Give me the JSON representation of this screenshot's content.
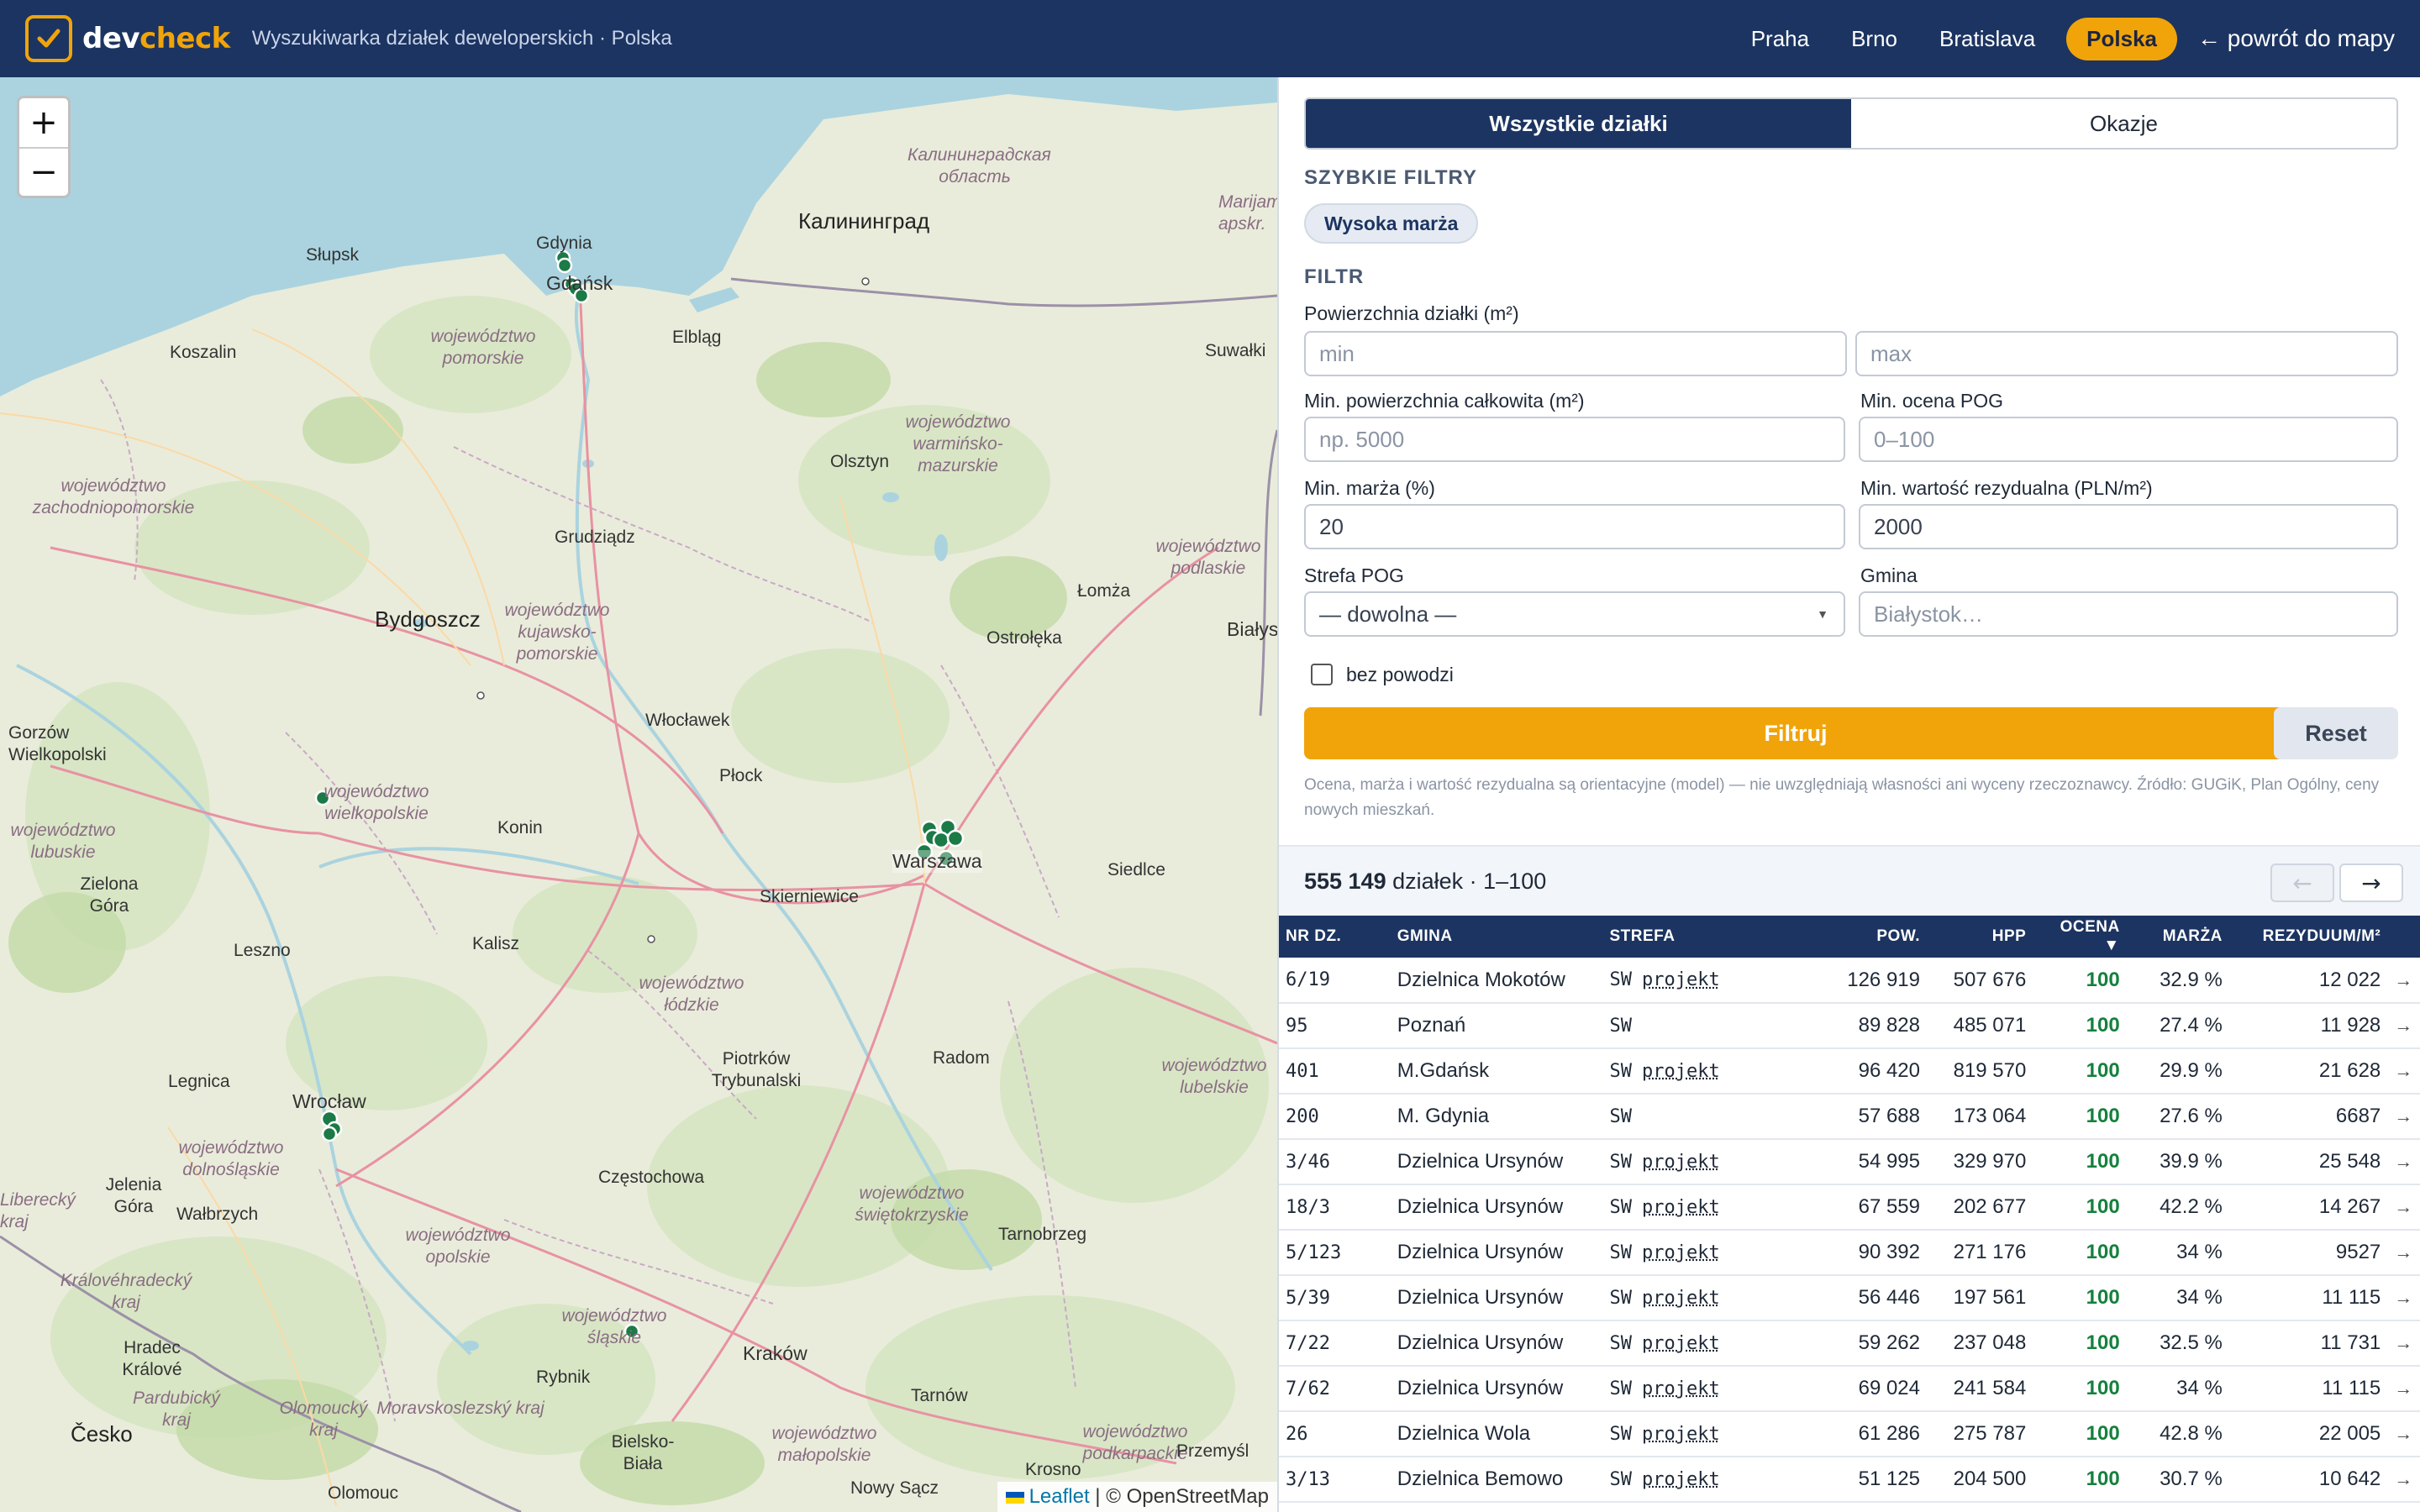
{
  "header": {
    "logo_dev": "dev",
    "logo_check": "check",
    "subtitle": "Wyszukiwarka działek deweloperskich · Polska",
    "nav": [
      "Praha",
      "Brno",
      "Bratislava",
      "Polska"
    ],
    "nav_active": "Polska",
    "back_link": "← powrót do mapy"
  },
  "map": {
    "zoom_in": "+",
    "zoom_out": "−",
    "attribution_leaflet": "Leaflet",
    "attribution_sep": " | © OpenStreetMap",
    "labels": {
      "kaliningrad_region": "Калининградская область",
      "kaliningrad": "Калининград",
      "marijampole": "Marijampolė apskr.",
      "slupsk": "Słupsk",
      "gdynia": "Gdynia",
      "gdansk": "Gdańsk",
      "koszalin": "Koszalin",
      "pomorskie": "województwo pomorskie",
      "elblag": "Elbląg",
      "suwalki": "Suwałki",
      "warminsko": "województwo warmińsko-mazurskie",
      "olsztyn": "Olsztyn",
      "zachodnio": "województwo zachodniopomorskie",
      "grudziadz": "Grudziądz",
      "podlaskie": "województwo podlaskie",
      "lomza": "Łomża",
      "bydgoszcz": "Bydgoszcz",
      "kujawsko": "województwo kujawsko-pomorskie",
      "ostroleka": "Ostrołęka",
      "bialystok": "Białystok",
      "wloclawek": "Włocławek",
      "gorzow": "Gorzów Wielkopolski",
      "wielkopolskie": "województwo wielkopolskie",
      "plock": "Płock",
      "lubuskie": "województwo lubuskie",
      "konin": "Konin",
      "warszawa": "Warszawa",
      "siedlce": "Siedlce",
      "zielona": "Zielona Góra",
      "skierniewice": "Skierniewice",
      "kalisz": "Kalisz",
      "leszno": "Leszno",
      "lodzkie": "województwo łódzkie",
      "piotrkow": "Piotrków Trybunalski",
      "radom": "Radom",
      "lubelskie": "województwo lubelskie",
      "legnica": "Legnica",
      "wroclaw": "Wrocław",
      "dolnoslaskie": "województwo dolnośląskie",
      "czestochowa": "Częstochowa",
      "jelenia": "Jelenia Góra",
      "walbrzych": "Wałbrzych",
      "swietokrzyskie": "województwo świętokrzyskie",
      "tarnobrzeg": "Tarnobrzeg",
      "liberecky": "Liberecký kraj",
      "opolskie": "województwo opolskie",
      "kralovehradecky": "Královéhradecký kraj",
      "slaskie": "województwo śląskie",
      "hradec": "Hradec Králové",
      "rybnik": "Rybnik",
      "krakow": "Kraków",
      "tarnow": "Tarnów",
      "pardubicky": "Pardubický kraj",
      "olomoucky": "Olomoucký kraj",
      "moravskoslezsky": "Moravskoslezský kraj",
      "malopolskie": "województwo małopolskie",
      "podkarpackie": "województwo podkarpackie",
      "cesko": "Česko",
      "bielsko": "Bielsko-Biała",
      "krosno": "Krosno",
      "przemysl": "Przemyśl",
      "nowy_sacz": "Nowy Sącz",
      "olomouc": "Olomouc"
    }
  },
  "panel": {
    "tabs": [
      "Wszystkie działki",
      "Okazje"
    ],
    "quick_filters_title": "SZYBKIE FILTRY",
    "quick_chip": "Wysoka marża",
    "filter_title": "FILTR",
    "area_label": "Powierzchnia działki (m²)",
    "area_min_ph": "min",
    "area_max_ph": "max",
    "total_area_label": "Min. powierzchnia całkowita (m²)",
    "total_area_ph": "np. 5000",
    "pog_score_label": "Min. ocena POG",
    "pog_score_ph": "0–100",
    "margin_label": "Min. marża (%)",
    "margin_value": "20",
    "residual_label": "Min. wartość rezydualna (PLN/m²)",
    "residual_value": "2000",
    "zone_label": "Strefa POG",
    "zone_value": "— dowolna —",
    "gmina_label": "Gmina",
    "gmina_ph": "Białystok…",
    "no_flood_label": "bez powodzi",
    "filter_button": "Filtruj",
    "reset_button": "Reset",
    "note": "Ocena, marża i wartość rezydualna są orientacyjne (model) — nie uwzględniają własności ani wyceny rzeczoznawcy. Źródło: GUGiK, Plan Ogólny, ceny nowych mieszkań.",
    "count_number": "555 149",
    "count_text": " działek · 1–100",
    "prev": "←",
    "next": "→"
  },
  "table": {
    "headers": [
      "NR DZ.",
      "GMINA",
      "STREFA",
      "POW.",
      "HPP",
      "OCENA ▼",
      "MARŻA",
      "REZYDUUM/M²"
    ],
    "rows": [
      {
        "nr": "6/19",
        "gmina": "Dzielnica Mokotów",
        "strefa": "SW",
        "proj": "projekt",
        "pow": "126 919",
        "hpp": "507 676",
        "ocena": "100",
        "marza": "32.9 %",
        "rez": "12 022",
        "arrow": "→"
      },
      {
        "nr": "95",
        "gmina": "Poznań",
        "strefa": "SW",
        "proj": "",
        "pow": "89 828",
        "hpp": "485 071",
        "ocena": "100",
        "marza": "27.4 %",
        "rez": "11 928",
        "arrow": "→"
      },
      {
        "nr": "401",
        "gmina": "M.Gdańsk",
        "strefa": "SW",
        "proj": "projekt",
        "pow": "96 420",
        "hpp": "819 570",
        "ocena": "100",
        "marza": "29.9 %",
        "rez": "21 628",
        "arrow": "→"
      },
      {
        "nr": "200",
        "gmina": "M. Gdynia",
        "strefa": "SW",
        "proj": "",
        "pow": "57 688",
        "hpp": "173 064",
        "ocena": "100",
        "marza": "27.6 %",
        "rez": "6687",
        "arrow": "→"
      },
      {
        "nr": "3/46",
        "gmina": "Dzielnica Ursynów",
        "strefa": "SW",
        "proj": "projekt",
        "pow": "54 995",
        "hpp": "329 970",
        "ocena": "100",
        "marza": "39.9 %",
        "rez": "25 548",
        "arrow": "→"
      },
      {
        "nr": "18/3",
        "gmina": "Dzielnica Ursynów",
        "strefa": "SW",
        "proj": "projekt",
        "pow": "67 559",
        "hpp": "202 677",
        "ocena": "100",
        "marza": "42.2 %",
        "rez": "14 267",
        "arrow": "→"
      },
      {
        "nr": "5/123",
        "gmina": "Dzielnica Ursynów",
        "strefa": "SW",
        "proj": "projekt",
        "pow": "90 392",
        "hpp": "271 176",
        "ocena": "100",
        "marza": "34 %",
        "rez": "9527",
        "arrow": "→"
      },
      {
        "nr": "5/39",
        "gmina": "Dzielnica Ursynów",
        "strefa": "SW",
        "proj": "projekt",
        "pow": "56 446",
        "hpp": "197 561",
        "ocena": "100",
        "marza": "34 %",
        "rez": "11 115",
        "arrow": "→"
      },
      {
        "nr": "7/22",
        "gmina": "Dzielnica Ursynów",
        "strefa": "SW",
        "proj": "projekt",
        "pow": "59 262",
        "hpp": "237 048",
        "ocena": "100",
        "marza": "32.5 %",
        "rez": "11 731",
        "arrow": "→"
      },
      {
        "nr": "7/62",
        "gmina": "Dzielnica Ursynów",
        "strefa": "SW",
        "proj": "projekt",
        "pow": "69 024",
        "hpp": "241 584",
        "ocena": "100",
        "marza": "34 %",
        "rez": "11 115",
        "arrow": "→"
      },
      {
        "nr": "26",
        "gmina": "Dzielnica Wola",
        "strefa": "SW",
        "proj": "projekt",
        "pow": "61 286",
        "hpp": "275 787",
        "ocena": "100",
        "marza": "42.8 %",
        "rez": "22 005",
        "arrow": "→"
      },
      {
        "nr": "3/13",
        "gmina": "Dzielnica Bemowo",
        "strefa": "SW",
        "proj": "projekt",
        "pow": "51 125",
        "hpp": "204 500",
        "ocena": "100",
        "marza": "30.7 %",
        "rez": "10 642",
        "arrow": "→"
      }
    ]
  },
  "colors": {
    "header_bg": "#1c3461",
    "accent": "#f0a40a",
    "score_green": "#15803d",
    "marker": "#1b7a46"
  }
}
